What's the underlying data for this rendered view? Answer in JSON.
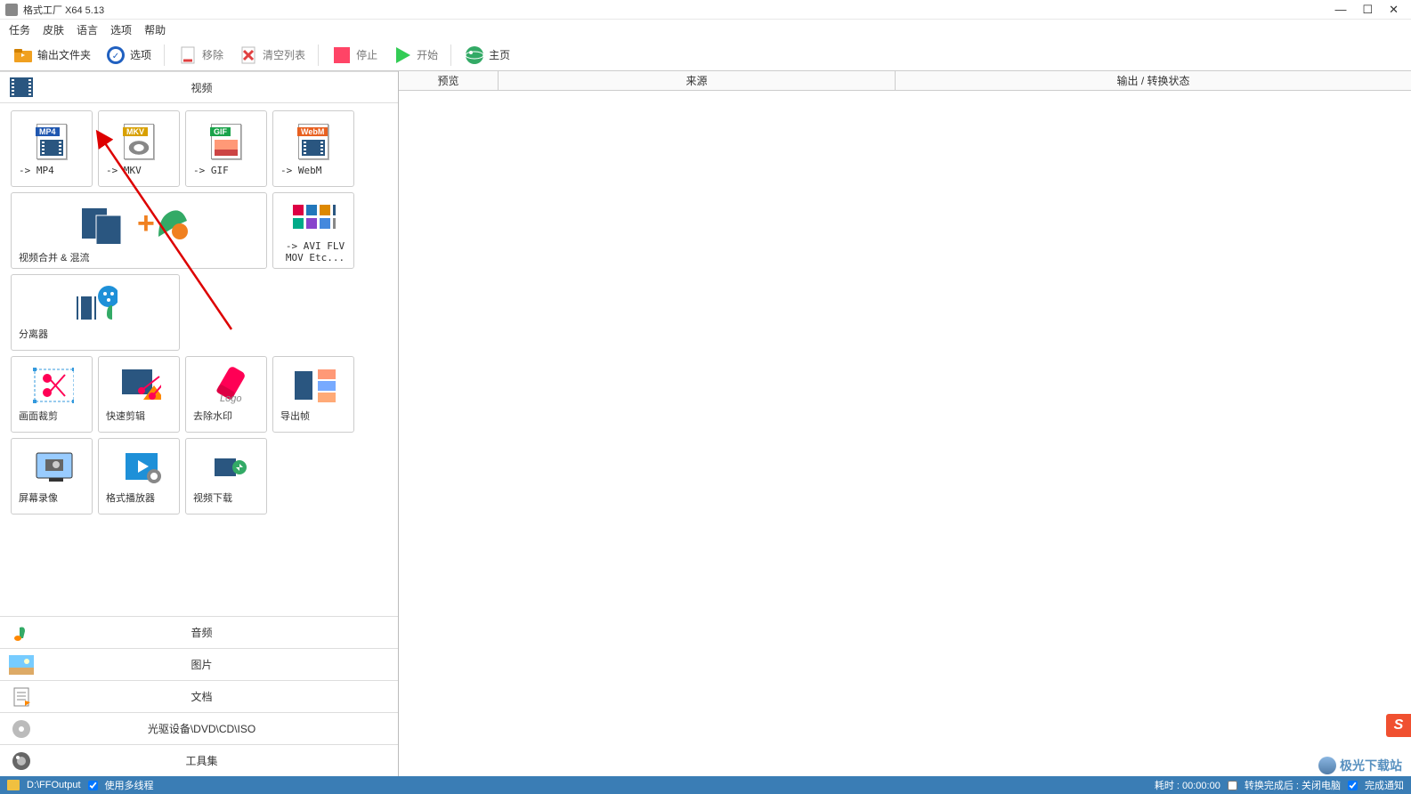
{
  "window": {
    "title": "格式工厂 X64 5.13"
  },
  "menu": [
    "任务",
    "皮肤",
    "语言",
    "选项",
    "帮助"
  ],
  "toolbar": {
    "output_folder": "输出文件夹",
    "options": "选项",
    "remove": "移除",
    "clear_list": "清空列表",
    "stop": "停止",
    "start": "开始",
    "homepage": "主页"
  },
  "categories": {
    "video": "视频",
    "audio": "音频",
    "image": "图片",
    "document": "文档",
    "disc": "光驱设备\\DVD\\CD\\ISO",
    "tools": "工具集"
  },
  "video_items": [
    {
      "key": "mp4",
      "label": "-> MP4",
      "tag": "MP4",
      "tag_color": "#2057b0"
    },
    {
      "key": "mkv",
      "label": "-> MKV",
      "tag": "MKV",
      "tag_color": "#d8a000"
    },
    {
      "key": "gif",
      "label": "-> GIF",
      "tag": "GIF",
      "tag_color": "#1aa34a"
    },
    {
      "key": "webm",
      "label": "-> WebM",
      "tag": "WebM",
      "tag_color": "#e86020"
    },
    {
      "key": "merge",
      "label": "视频合并 & 混流",
      "wide": true
    },
    {
      "key": "more",
      "label": "-> AVI FLV MOV Etc..."
    },
    {
      "key": "split",
      "label": "分离器"
    },
    {
      "key": "crop",
      "label": "画面裁剪"
    },
    {
      "key": "quickcut",
      "label": "快速剪辑"
    },
    {
      "key": "watermark",
      "label": "去除水印"
    },
    {
      "key": "exportframe",
      "label": "导出帧"
    },
    {
      "key": "screenrec",
      "label": "屏幕录像"
    },
    {
      "key": "player",
      "label": "格式播放器"
    },
    {
      "key": "download",
      "label": "视频下载"
    }
  ],
  "columns": {
    "preview": "预览",
    "source": "来源",
    "output": "输出 / 转换状态"
  },
  "statusbar": {
    "path": "D:\\FFOutput",
    "multithread": "使用多线程",
    "elapsed": "耗时 : 00:00:00",
    "shutdown": "转换完成后 : 关闭电脑",
    "notify": "完成通知"
  },
  "watermark_text": "极光下载站",
  "ime_badge": "S"
}
